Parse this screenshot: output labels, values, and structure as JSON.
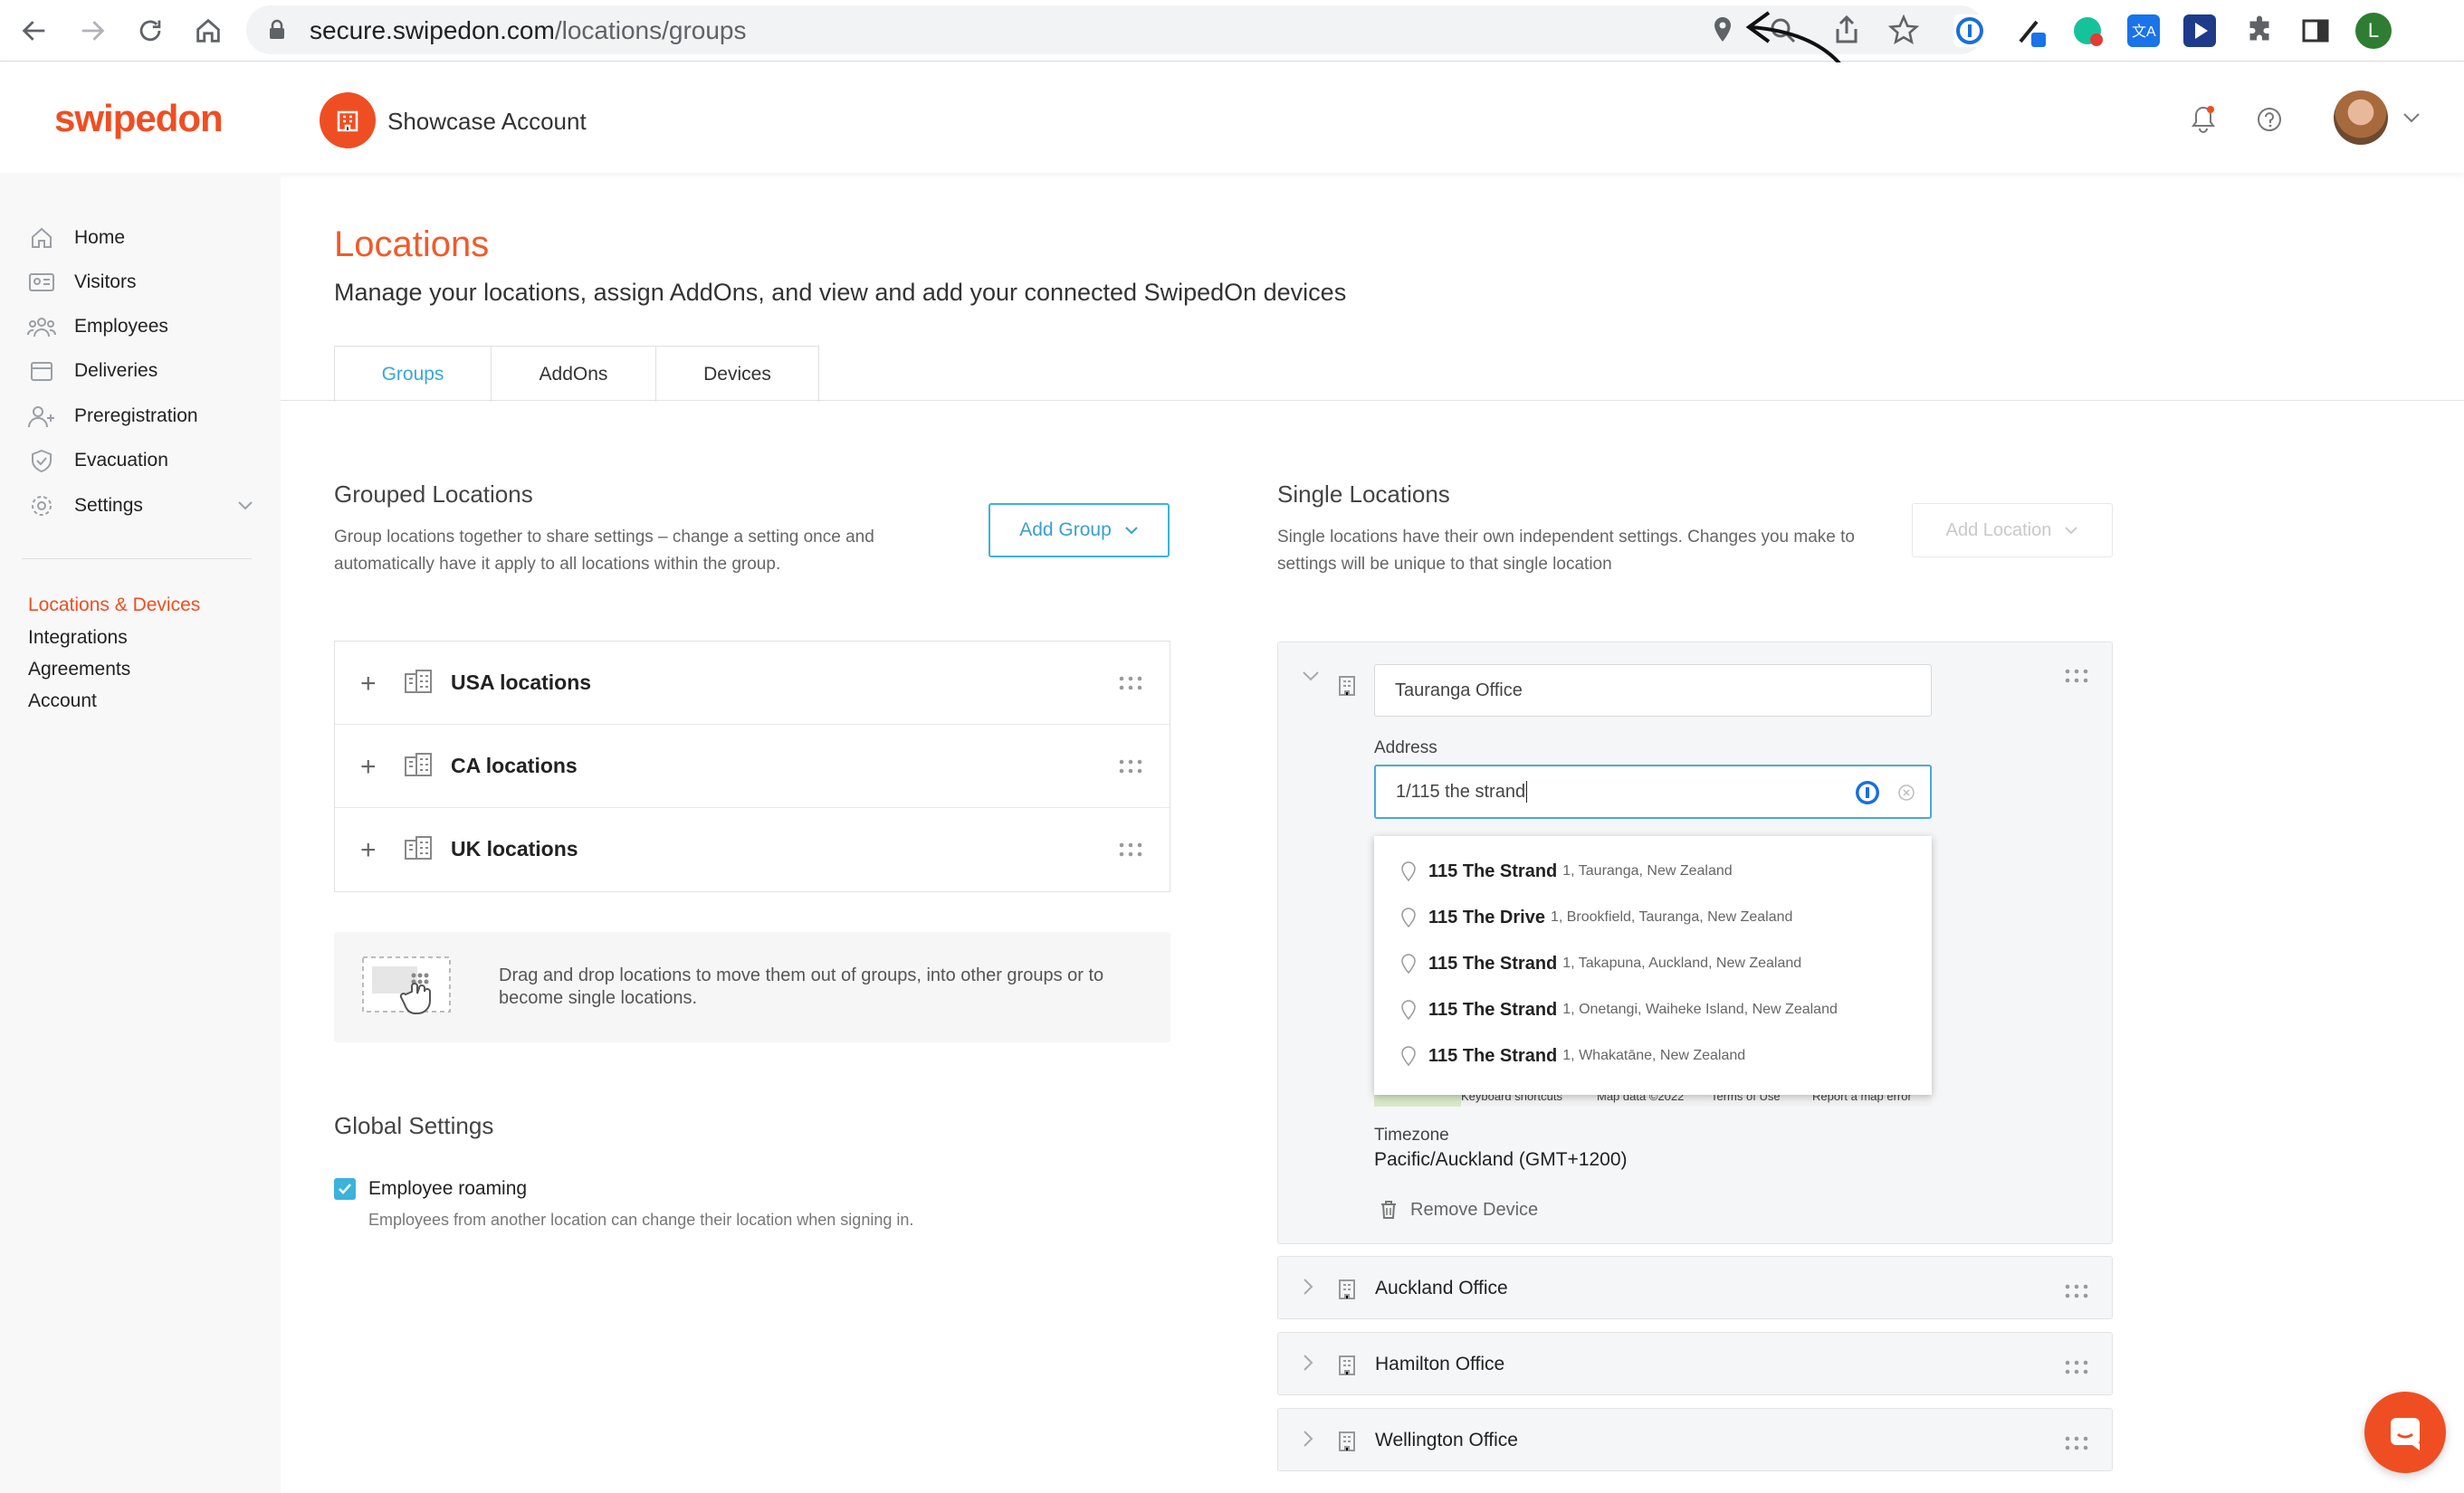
{
  "browser": {
    "url_host": "secure.swipedon.com",
    "url_path": "/locations/groups",
    "profile_initial": "L"
  },
  "header": {
    "logo": "swipedon",
    "account_name": "Showcase Account"
  },
  "sidebar": {
    "items": [
      {
        "label": "Home",
        "icon": "home-icon"
      },
      {
        "label": "Visitors",
        "icon": "visitors-icon"
      },
      {
        "label": "Employees",
        "icon": "employees-icon"
      },
      {
        "label": "Deliveries",
        "icon": "deliveries-icon"
      },
      {
        "label": "Preregistration",
        "icon": "preregistration-icon"
      },
      {
        "label": "Evacuation",
        "icon": "evacuation-icon"
      },
      {
        "label": "Settings",
        "icon": "gear-icon"
      }
    ],
    "links": [
      "Locations & Devices",
      "Integrations",
      "Agreements",
      "Account"
    ],
    "active_link_color": "#ef4e23"
  },
  "main": {
    "title": "Locations",
    "subtitle": "Manage your locations, assign AddOns, and view and add your connected SwipedOn devices",
    "tabs": [
      "Groups",
      "AddOns",
      "Devices"
    ],
    "grouped": {
      "title": "Grouped Locations",
      "desc_line1": "Group locations together to share settings – change a setting once and",
      "desc_line2": "automatically have it apply to all locations within the group.",
      "add_button": "Add Group",
      "groups": [
        "USA locations",
        "CA locations",
        "UK locations"
      ],
      "tip_line1": "Drag and drop locations to move them out of groups, into other groups or to",
      "tip_line2": "become single locations."
    },
    "global": {
      "title": "Global Settings",
      "roaming_label": "Employee roaming",
      "roaming_desc": "Employees from another location can change their location when signing in."
    },
    "single": {
      "title": "Single Locations",
      "desc_line1": "Single locations have their own independent settings. Changes you make to",
      "desc_line2": "settings will be unique to that single location",
      "add_button": "Add Location",
      "expanded": {
        "name": "Tauranga Office",
        "address_label": "Address",
        "address_value": "1/115 the strand",
        "suggestions": [
          {
            "main": "115 The Strand",
            "secondary": "1, Tauranga, New Zealand"
          },
          {
            "main": "115 The Drive",
            "secondary": "1, Brookfield, Tauranga, New Zealand"
          },
          {
            "main": "115 The Strand",
            "secondary": "1, Takapuna, Auckland, New Zealand"
          },
          {
            "main": "115 The Strand",
            "secondary": "1, Onetangi, Waiheke Island, New Zealand"
          },
          {
            "main": "115 The Strand",
            "secondary": "1, Whakatāne, New Zealand"
          }
        ],
        "map_footer": [
          "Keyboard shortcuts",
          "Map data ©2022",
          "Terms of Use",
          "Report a map error"
        ],
        "timezone_label": "Timezone",
        "timezone_value": "Pacific/Auckland (GMT+1200)",
        "remove_device": "Remove Device"
      },
      "locations": [
        "Auckland Office",
        "Hamilton Office",
        "Wellington Office"
      ]
    }
  }
}
